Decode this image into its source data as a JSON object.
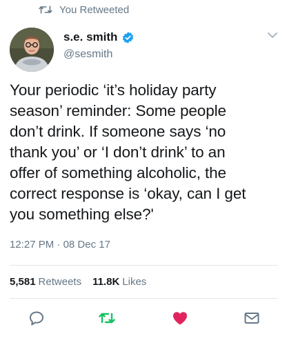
{
  "context": {
    "label": "You Retweeted"
  },
  "author": {
    "name": "s.e. smith",
    "handle": "@sesmith",
    "verified": true
  },
  "tweet": {
    "lines": [
      "Your periodic ‘it’s holiday party",
      "season’ reminder: Some people",
      "don’t drink. If someone says ‘no",
      "thank you’ or ‘I don’t drink’ to an",
      "offer of something alcoholic, the",
      "correct response is ‘okay, can I get",
      "you something else?'"
    ],
    "time": "12:27 PM",
    "separator": "·",
    "date": "08 Dec 17"
  },
  "stats": {
    "retweets_count": "5,581",
    "retweets_label": "Retweets",
    "likes_count": "11.8K",
    "likes_label": "Likes"
  },
  "actions": {
    "reply_icon": "reply-icon",
    "retweet_icon": "retweet-icon",
    "like_icon": "heart-icon",
    "dm_icon": "mail-icon"
  },
  "colors": {
    "text": "#14171a",
    "secondary": "#657786",
    "retweet_active": "#17bf63",
    "like_active": "#e0245e",
    "verified": "#1da1f2"
  }
}
